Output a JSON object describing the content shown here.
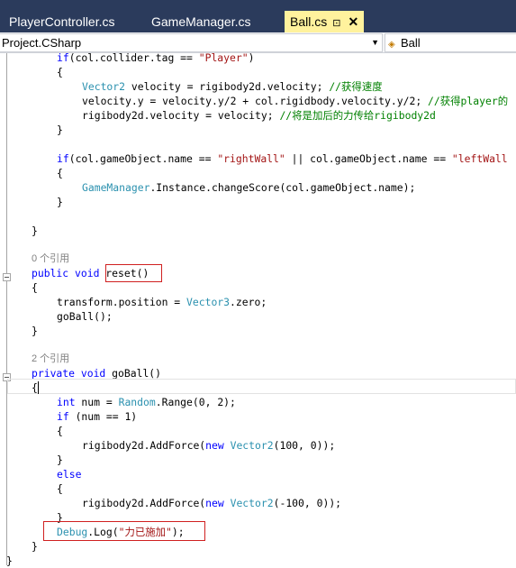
{
  "tabs": [
    {
      "label": "PlayerController.cs"
    },
    {
      "label": "GameManager.cs"
    },
    {
      "label": "Ball.cs",
      "pin": "⊡",
      "close": "✕"
    }
  ],
  "nav": {
    "project": "Project.CSharp",
    "member": "Ball"
  },
  "refs": {
    "reset_refs": "0 个引用",
    "goball_refs": "2 个引用"
  },
  "code": {
    "l1": "if(col.collider.tag == \"Player\")",
    "l3a": "Vector2",
    "l3b": " velocity = rigibody2d.velocity; ",
    "l3c": "//获得速度",
    "l4a": "velocity.y = velocity.y/2 + col.rigidbody.velocity.y/2; ",
    "l4b": "//获得player的",
    "l5a": "rigibody2d.velocity = velocity; ",
    "l5b": "//将是加后的力传给rigibody2d",
    "l8": "if(col.gameObject.name == \"rightWall\" || col.gameObject.name == \"leftWall",
    "l10a": "GameManager",
    "l10b": ".Instance.changeScore(col.gameObject.name);",
    "reset_sig_a": "public void ",
    "reset_sig_b": "reset()",
    "r1a": "transform.position = ",
    "r1b": "Vector3",
    "r1c": ".zero;",
    "r2": "goBall();",
    "goball_sig_a": "private void ",
    "goball_sig_b": "goBall()",
    "g1a": "int",
    "g1b": " num = ",
    "g1c": "Random",
    "g1d": ".Range(0, 2);",
    "g2a": "if",
    "g2b": " (num == 1)",
    "g3a": "rigibody2d.AddForce(",
    "g3b": "new",
    "g3c": " ",
    "g3d": "Vector2",
    "g3e": "(100, 0));",
    "g4": "else",
    "g5a": "rigibody2d.AddForce(",
    "g5b": "new",
    "g5d": "Vector2",
    "g5e": "(-100, 0));",
    "d1a": "Debug",
    "d1b": ".Log(",
    "d1c": "\"力已施加\"",
    "d1d": ");",
    "open": "{",
    "close": "}"
  }
}
